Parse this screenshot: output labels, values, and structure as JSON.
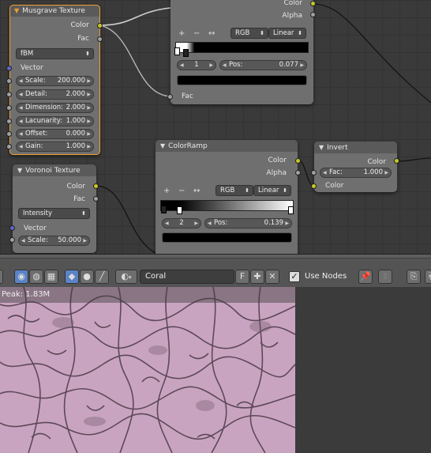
{
  "musgrave": {
    "title": "Musgrave Texture",
    "out_color": "Color",
    "out_fac": "Fac",
    "type": "fBM",
    "in_vector": "Vector",
    "fields": [
      {
        "label": "Scale:",
        "value": "200.000"
      },
      {
        "label": "Detail:",
        "value": "2.000"
      },
      {
        "label": "Dimension:",
        "value": "2.000"
      },
      {
        "label": "Lacunarity:",
        "value": "1.000"
      },
      {
        "label": "Offset:",
        "value": "0.000"
      },
      {
        "label": "Gain:",
        "value": "1.000"
      }
    ]
  },
  "ramp1": {
    "out_color": "Color",
    "out_alpha": "Alpha",
    "plus": "+",
    "minus": "−",
    "flip": "↔",
    "mode": "RGB",
    "interp": "Linear",
    "index": "1",
    "pos_label": "Pos:",
    "pos_value": "0.077",
    "in_fac": "Fac"
  },
  "voronoi": {
    "title": "Voronoi Texture",
    "out_color": "Color",
    "out_fac": "Fac",
    "coloring": "Intensity",
    "in_vector": "Vector",
    "scale_label": "Scale:",
    "scale_value": "50.000"
  },
  "ramp2": {
    "title": "ColorRamp",
    "out_color": "Color",
    "out_alpha": "Alpha",
    "plus": "+",
    "minus": "−",
    "flip": "↔",
    "mode": "RGB",
    "interp": "Linear",
    "index": "2",
    "pos_label": "Pos:",
    "pos_value": "0.139"
  },
  "invert": {
    "title": "Invert",
    "out_color": "Color",
    "fac_label": "Fac:",
    "fac_value": "1.000",
    "in_color": "Color"
  },
  "header": {
    "material_name": "Coral",
    "fake_user": "F",
    "use_nodes_label": "Use Nodes",
    "use_nodes_checked": "✓"
  },
  "preview": {
    "peak_text": "Peak: 1.83M"
  },
  "icons": [
    "node-tree-icon",
    "world-icon",
    "texture-icon",
    "object-icon",
    "material-icon",
    "pin-icon",
    "parent-icon",
    "copy-icon"
  ],
  "colors": {
    "socket_color": "#c7c729",
    "socket_float": "#a1a1a1",
    "socket_vector": "#6363c7",
    "active_outline": "#f0a030",
    "preview_pink": "#c9a4c0"
  }
}
